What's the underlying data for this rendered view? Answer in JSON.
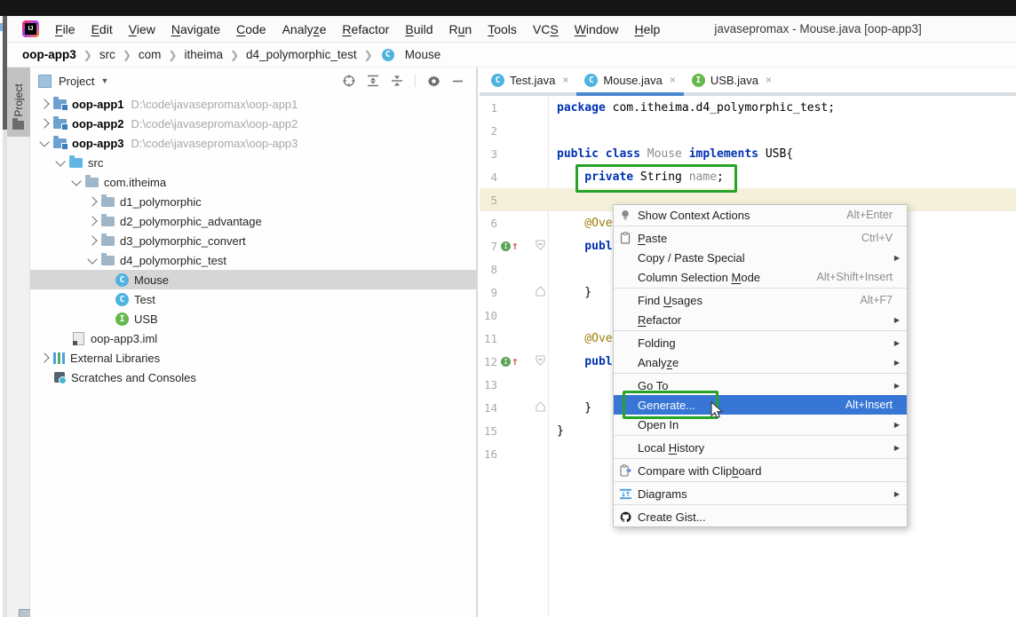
{
  "window": {
    "title": "javasepromax - Mouse.java [oop-app3]",
    "app_icon": "intellij-idea-logo"
  },
  "menubar": {
    "items": [
      {
        "pre": "",
        "m": "F",
        "post": "ile"
      },
      {
        "pre": "",
        "m": "E",
        "post": "dit"
      },
      {
        "pre": "",
        "m": "V",
        "post": "iew"
      },
      {
        "pre": "",
        "m": "N",
        "post": "avigate"
      },
      {
        "pre": "",
        "m": "C",
        "post": "ode"
      },
      {
        "pre": "Analy",
        "m": "z",
        "post": "e"
      },
      {
        "pre": "",
        "m": "R",
        "post": "efactor"
      },
      {
        "pre": "",
        "m": "B",
        "post": "uild"
      },
      {
        "pre": "R",
        "m": "u",
        "post": "n"
      },
      {
        "pre": "",
        "m": "T",
        "post": "ools"
      },
      {
        "pre": "VC",
        "m": "S",
        "post": ""
      },
      {
        "pre": "",
        "m": "W",
        "post": "indow"
      },
      {
        "pre": "",
        "m": "H",
        "post": "elp"
      }
    ]
  },
  "breadcrumb": {
    "segments": [
      "oop-app3",
      "src",
      "com",
      "itheima",
      "d4_polymorphic_test"
    ],
    "leaf": {
      "label": "Mouse",
      "icon": "class-icon"
    }
  },
  "project_panel": {
    "title": "Project",
    "stripe_tab": "Project",
    "toolbar_icons": [
      "locate",
      "expand-all",
      "collapse-all",
      "settings",
      "hide"
    ],
    "tree": [
      {
        "label": "oop-app1",
        "path": "D:\\code\\javasepromax\\oop-app1",
        "icon": "module-folder",
        "state": "collapsed"
      },
      {
        "label": "oop-app2",
        "path": "D:\\code\\javasepromax\\oop-app2",
        "icon": "module-folder",
        "state": "collapsed"
      },
      {
        "label": "oop-app3",
        "path": "D:\\code\\javasepromax\\oop-app3",
        "icon": "module-folder",
        "state": "expanded"
      },
      {
        "label": "src",
        "icon": "source-folder",
        "state": "expanded"
      },
      {
        "label": "com.itheima",
        "icon": "package-folder",
        "state": "expanded"
      },
      {
        "label": "d1_polymorphic",
        "icon": "package-folder",
        "state": "collapsed"
      },
      {
        "label": "d2_polymorphic_advantage",
        "icon": "package-folder",
        "state": "collapsed"
      },
      {
        "label": "d3_polymorphic_convert",
        "icon": "package-folder",
        "state": "collapsed"
      },
      {
        "label": "d4_polymorphic_test",
        "icon": "package-folder",
        "state": "expanded"
      },
      {
        "label": "Mouse",
        "icon": "class",
        "selected": true
      },
      {
        "label": "Test",
        "icon": "class"
      },
      {
        "label": "USB",
        "icon": "interface"
      },
      {
        "label": "oop-app3.iml",
        "icon": "module-file"
      },
      {
        "label": "External Libraries",
        "icon": "libraries",
        "state": "collapsed"
      },
      {
        "label": "Scratches and Consoles",
        "icon": "scratches"
      }
    ]
  },
  "tabs": [
    {
      "label": "Test.java",
      "icon": "class",
      "close": "×"
    },
    {
      "label": "Mouse.java",
      "icon": "class",
      "close": "×",
      "active": true
    },
    {
      "label": "USB.java",
      "icon": "interface",
      "close": "×"
    }
  ],
  "editor": {
    "lines": [
      {
        "num": "1",
        "tokens": [
          {
            "c": "kw",
            "t": "package "
          },
          {
            "c": "pl",
            "t": "com.itheima.d4_polymorphic_test;"
          }
        ]
      },
      {
        "num": "2",
        "tokens": []
      },
      {
        "num": "3",
        "tokens": [
          {
            "c": "kw",
            "t": "public class "
          },
          {
            "c": "gy",
            "t": "Mouse "
          },
          {
            "c": "kw",
            "t": "implements "
          },
          {
            "c": "pl",
            "t": "USB{"
          }
        ]
      },
      {
        "num": "4",
        "tokens": [
          {
            "c": "kw",
            "t": "    private "
          },
          {
            "c": "pl",
            "t": "String "
          },
          {
            "c": "gy",
            "t": "name"
          },
          {
            "c": "pl",
            "t": ";"
          }
        ]
      },
      {
        "num": "5",
        "tokens": [],
        "current_line": true
      },
      {
        "num": "6",
        "tokens": [
          {
            "c": "an",
            "t": "    @Over"
          }
        ]
      },
      {
        "num": "7",
        "tokens": [
          {
            "c": "kw",
            "t": "    publ"
          }
        ],
        "gutter": "overrides"
      },
      {
        "num": "8",
        "tokens": []
      },
      {
        "num": "9",
        "tokens": [
          {
            "c": "pl",
            "t": "    }"
          }
        ]
      },
      {
        "num": "10",
        "tokens": []
      },
      {
        "num": "11",
        "tokens": [
          {
            "c": "an",
            "t": "    @Over"
          }
        ]
      },
      {
        "num": "12",
        "tokens": [
          {
            "c": "kw",
            "t": "    publ"
          }
        ],
        "gutter": "overrides"
      },
      {
        "num": "13",
        "tokens": []
      },
      {
        "num": "14",
        "tokens": [
          {
            "c": "pl",
            "t": "    }"
          }
        ]
      },
      {
        "num": "15",
        "tokens": [
          {
            "c": "pl",
            "t": "}"
          }
        ]
      },
      {
        "num": "16",
        "tokens": []
      }
    ]
  },
  "context_menu": {
    "items": [
      {
        "pre": "Show Context Actions",
        "m": "",
        "post": "",
        "shortcut": "Alt+Enter",
        "icon": "lightbulb"
      },
      {
        "pre": "",
        "m": "P",
        "post": "aste",
        "shortcut": "Ctrl+V",
        "icon": "clipboard"
      },
      {
        "pre": "Copy / Paste Special",
        "m": "",
        "post": "",
        "shortcut": "",
        "submenu": true
      },
      {
        "pre": "Column Selection ",
        "m": "M",
        "post": "ode",
        "shortcut": "Alt+Shift+Insert"
      },
      {
        "pre": "Find ",
        "m": "U",
        "post": "sages",
        "shortcut": "Alt+F7"
      },
      {
        "pre": "",
        "m": "R",
        "post": "efactor",
        "shortcut": "",
        "submenu": true
      },
      {
        "pre": "Folding",
        "m": "",
        "post": "",
        "shortcut": "",
        "submenu": true
      },
      {
        "pre": "Analy",
        "m": "z",
        "post": "e",
        "shortcut": "",
        "submenu": true
      },
      {
        "pre": "",
        "m": "Go To",
        "post": "",
        "shortcut": "",
        "submenu": true
      },
      {
        "pre": "Generate...",
        "m": "",
        "post": "",
        "shortcut": "Alt+Insert",
        "selected": true
      },
      {
        "pre": "Open In",
        "m": "",
        "post": "",
        "shortcut": "",
        "submenu": true
      },
      {
        "pre": "Local ",
        "m": "H",
        "post": "istory",
        "shortcut": "",
        "submenu": true
      },
      {
        "pre": "Compare with Clip",
        "m": "b",
        "post": "oard",
        "shortcut": "",
        "icon": "compare-clipboard"
      },
      {
        "pre": "Diagrams",
        "m": "",
        "post": "",
        "shortcut": "",
        "submenu": true,
        "icon": "diagrams"
      },
      {
        "pre": "Create Gist...",
        "m": "",
        "post": "",
        "shortcut": "",
        "icon": "github-octocat"
      }
    ]
  },
  "annotations": {
    "highlight_color": "#27A327",
    "boxes": [
      "private String name;",
      "Generate..."
    ]
  },
  "colors": {
    "menu_selection": "#3876D6",
    "active_tab_underline": "#4787CE",
    "current_line": "#F5F0DA",
    "tree_selection": "#D6D6D6",
    "keyword": "#0033B3",
    "annotation_token": "#9E7E0A"
  }
}
